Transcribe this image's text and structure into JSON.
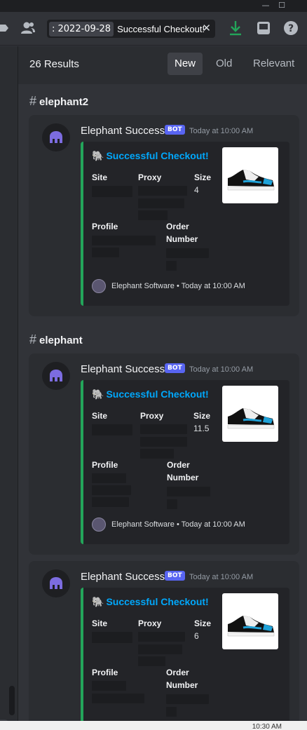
{
  "window": {
    "minimize_icon": "minimize-icon",
    "maximize_icon": "maximize-icon",
    "minimize_glyph": "—",
    "maximize_glyph": "☐"
  },
  "toolbar": {
    "search_chip": ": 2022-09-28",
    "search_text": "Successful Checkout!",
    "clear_glyph": "✕"
  },
  "results": {
    "count": "26 Results",
    "tabs": [
      "New",
      "Old",
      "Relevant"
    ],
    "active_tab": "New"
  },
  "groups": [
    {
      "channel": "elephant2",
      "messages": [
        {
          "author": "Elephant Success",
          "bot_tag": "BOT",
          "time": "Today at 10:00 AM",
          "embed_title": "Successful Checkout!",
          "fields": {
            "site": "Site",
            "proxy": "Proxy",
            "size": "Size",
            "size_value": "4",
            "profile": "Profile",
            "order_number": "Order Number"
          },
          "footer": "Elephant Software • Today at 10:00 AM"
        }
      ]
    },
    {
      "channel": "elephant",
      "messages": [
        {
          "author": "Elephant Success",
          "bot_tag": "BOT",
          "time": "Today at 10:00 AM",
          "embed_title": "Successful Checkout!",
          "fields": {
            "site": "Site",
            "proxy": "Proxy",
            "size": "Size",
            "size_value": "11.5",
            "profile": "Profile",
            "order_number": "Order Number"
          },
          "footer": "Elephant Software • Today at 10:00 AM"
        },
        {
          "author": "Elephant Success",
          "bot_tag": "BOT",
          "time": "Today at 10:00 AM",
          "embed_title": "Successful Checkout!",
          "fields": {
            "site": "Site",
            "proxy": "Proxy",
            "size": "Size",
            "size_value": "6",
            "profile": "Profile",
            "order_number": "Order Number"
          },
          "footer": ""
        }
      ]
    }
  ],
  "taskbar": {
    "clock": "10:30 AM"
  },
  "colors": {
    "accent": "#5865f2",
    "embed_bar": "#23a55a",
    "link": "#00a8fc"
  }
}
